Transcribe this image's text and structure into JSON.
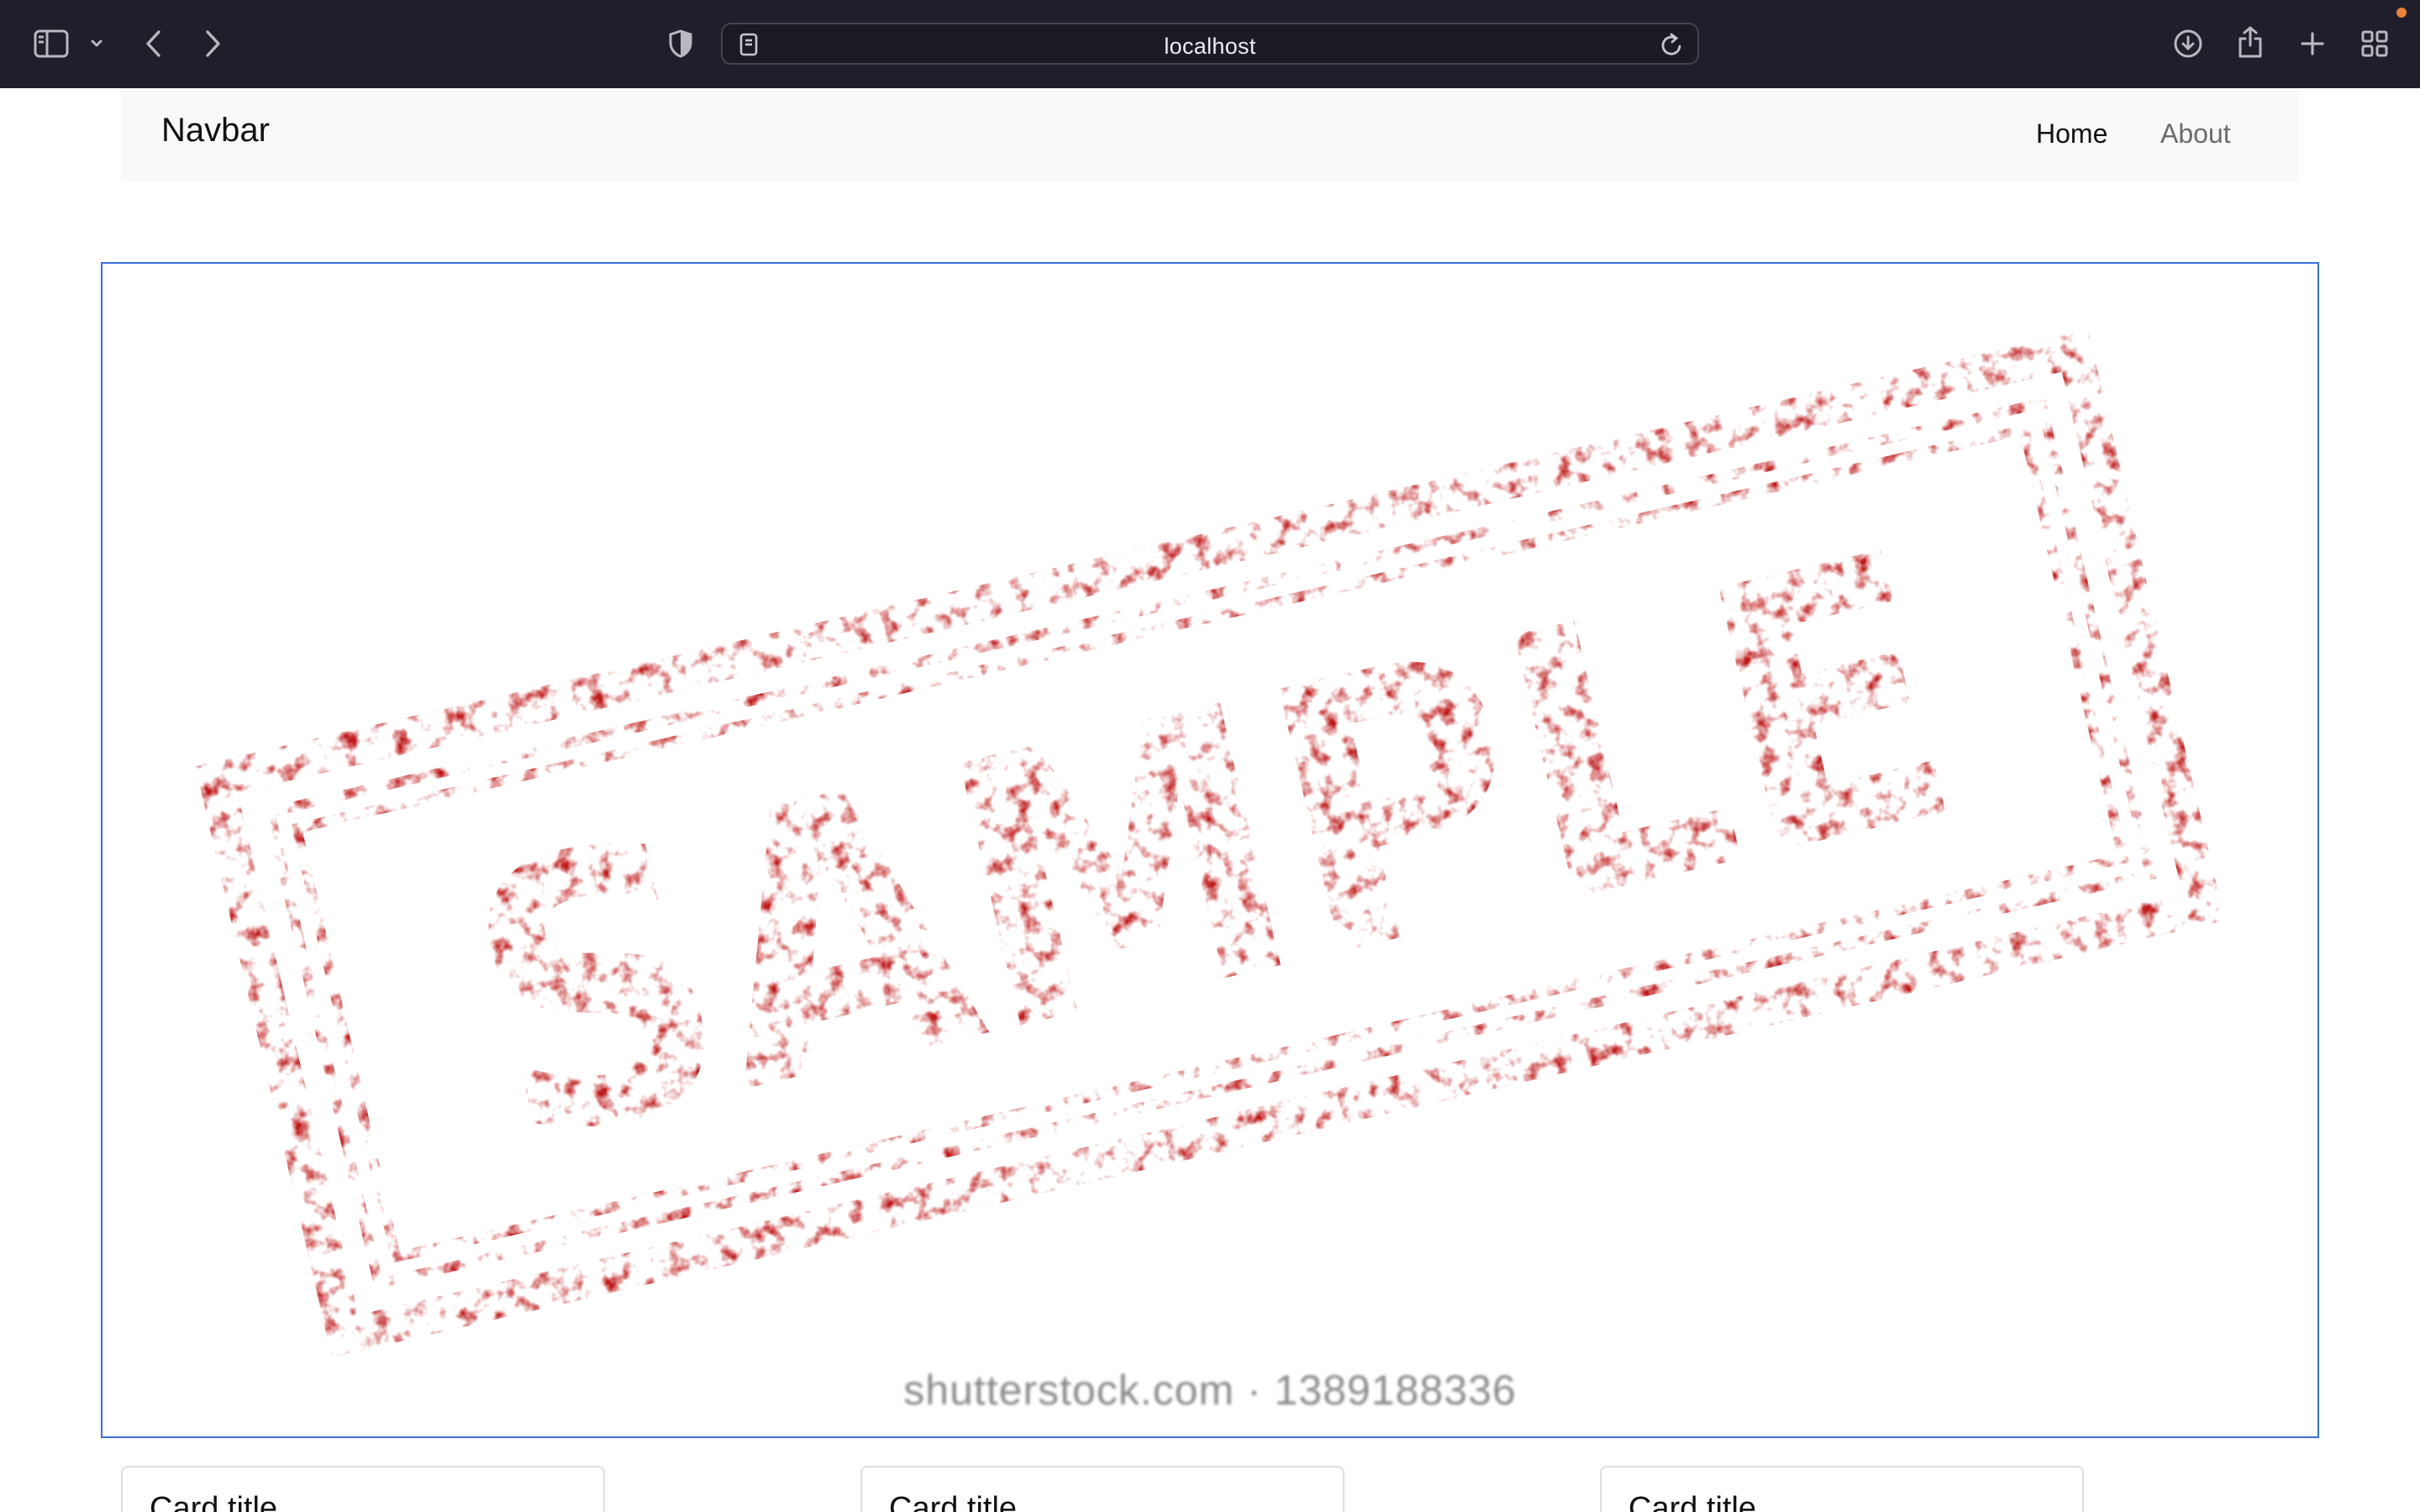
{
  "browser": {
    "address": "localhost",
    "icons": {
      "sidebar": "sidebar-icon",
      "sidebar_menu": "chevron-down-icon",
      "back": "chevron-left-icon",
      "forward": "chevron-right-icon",
      "privacy": "shield-icon",
      "page": "page-icon",
      "reload": "reload-icon",
      "downloads": "download-icon",
      "share": "share-icon",
      "new_tab": "plus-icon",
      "tab_overview": "grid-icon"
    },
    "notification_color": "#e8833a"
  },
  "navbar": {
    "brand": "Navbar",
    "links": [
      {
        "label": "Home",
        "active": true
      },
      {
        "label": "About",
        "active": false
      }
    ],
    "background": "#f8f9fa"
  },
  "carousel": {
    "slide_text": "SAMPLE",
    "watermark": "shutterstock.com · 1389188336",
    "border_color": "#3b6fd8",
    "stamp_color": "#c01f1f"
  },
  "cards": [
    {
      "title": "Card title"
    },
    {
      "title": "Card title"
    },
    {
      "title": "Card title"
    }
  ]
}
